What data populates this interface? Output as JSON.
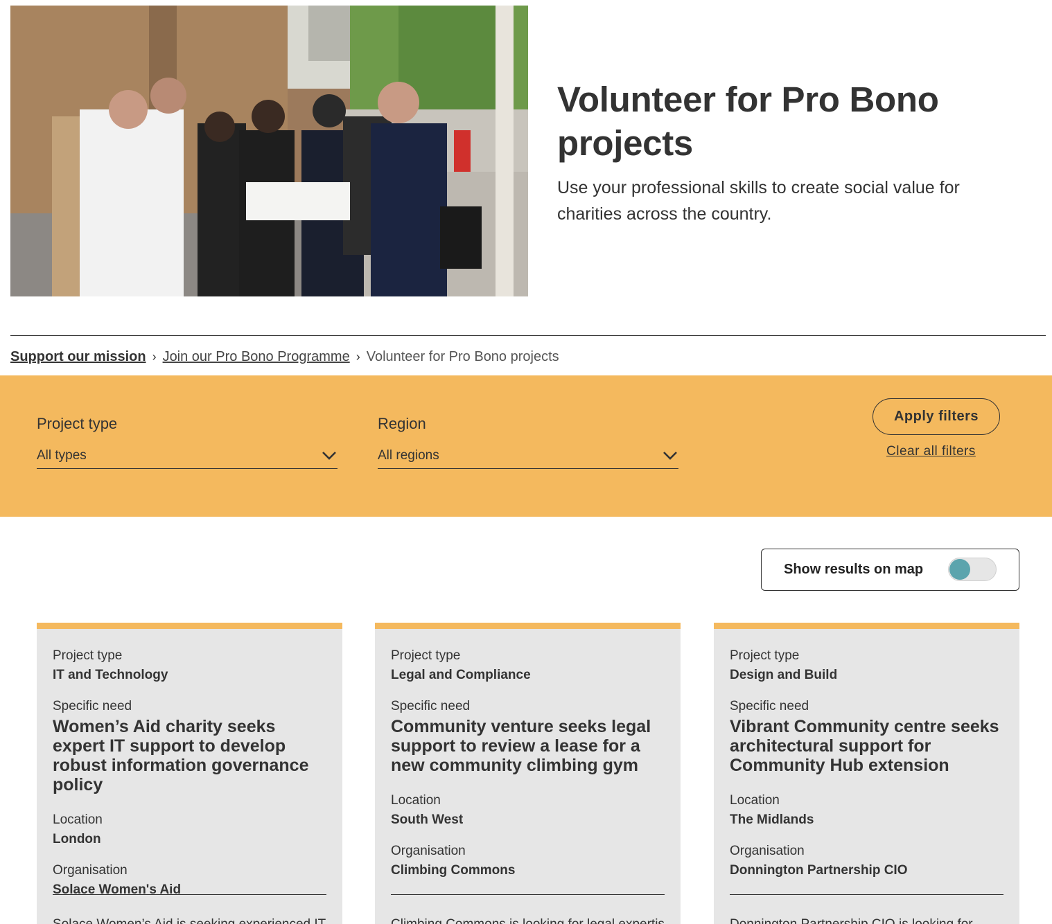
{
  "hero": {
    "title": "Volunteer for Pro Bono projects",
    "subtitle": "Use your professional skills to create social value for charities across the country."
  },
  "breadcrumb": {
    "items": [
      {
        "label": "Support our mission"
      },
      {
        "label": "Join our Pro Bono Programme"
      },
      {
        "label": "Volunteer for Pro Bono projects"
      }
    ]
  },
  "filters": {
    "project_type": {
      "label": "Project type",
      "value": "All types"
    },
    "region": {
      "label": "Region",
      "value": "All regions"
    },
    "apply_label": "Apply filters",
    "clear_label": "Clear all filters"
  },
  "map_toggle": {
    "label": "Show results on map"
  },
  "cards": [
    {
      "project_type_label": "Project type",
      "project_type": "IT and Technology",
      "need_label": "Specific need",
      "need": "Women’s Aid charity seeks expert IT support to develop robust information governance policy",
      "location_label": "Location",
      "location": "London",
      "organisation_label": "Organisation",
      "organisation": "Solace Women's Aid",
      "description": "Solace Women’s Aid is seeking experienced IT"
    },
    {
      "project_type_label": "Project type",
      "project_type": "Legal and Compliance",
      "need_label": "Specific need",
      "need": "Community venture seeks legal support to review a lease for a new community climbing gym",
      "location_label": "Location",
      "location": "South West",
      "organisation_label": "Organisation",
      "organisation": "Climbing Commons",
      "description": "Climbing Commons is looking for legal expertise"
    },
    {
      "project_type_label": "Project type",
      "project_type": "Design and Build",
      "need_label": "Specific need",
      "need": "Vibrant Community centre seeks architectural support for Community Hub extension",
      "location_label": "Location",
      "location": "The Midlands",
      "organisation_label": "Organisation",
      "organisation": "Donnington Partnership CIO",
      "description": "Donnington Partnership CIO is looking for"
    }
  ],
  "colors": {
    "accent": "#f4b95e",
    "card_bg": "#e6e6e6",
    "toggle_knob": "#5ba4ad",
    "text": "#333333"
  },
  "icons": {
    "breadcrumb_separator": "chevron-right-icon",
    "select_arrow": "chevron-down-icon"
  }
}
